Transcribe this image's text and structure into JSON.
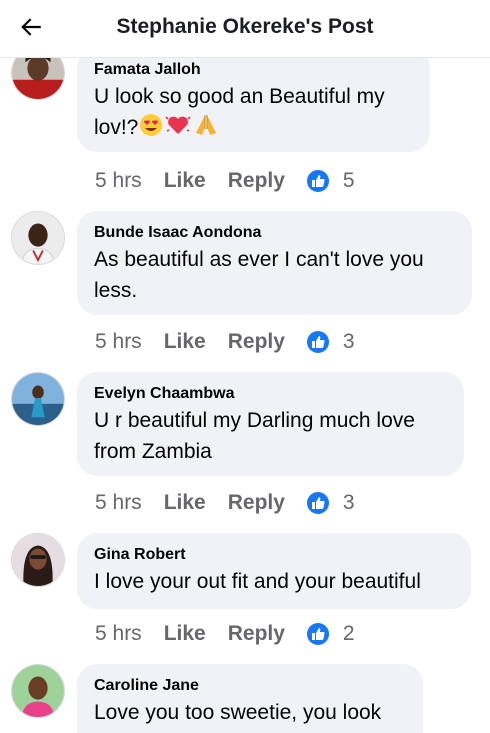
{
  "header": {
    "title": "Stephanie Okereke's Post",
    "back_icon": "arrow-left-icon"
  },
  "colors": {
    "bubble": "#f0f2f5",
    "meta": "#65676b",
    "like_blue": "#1877f2"
  },
  "comments": [
    {
      "author": "Famata Jalloh",
      "text_line1": "U look so good an Beautiful my",
      "text_line2": "lov!?",
      "emojis": [
        "heart-eyes-emoji",
        "sparkling-heart-emoji",
        "folded-hands-emoji"
      ],
      "time": "5 hrs",
      "like": "Like",
      "reply": "Reply",
      "reactions": "5"
    },
    {
      "author": "Bunde Isaac Aondona",
      "text_line1": "As beautiful as ever I can't love you",
      "text_line2": "less.",
      "time": "5 hrs",
      "like": "Like",
      "reply": "Reply",
      "reactions": "3"
    },
    {
      "author": "Evelyn Chaambwa",
      "text_line1": "U r beautiful my Darling much love",
      "text_line2": "from Zambia",
      "time": "5 hrs",
      "like": "Like",
      "reply": "Reply",
      "reactions": "3"
    },
    {
      "author": "Gina Robert",
      "text_line1": "I love your out fit and your beautiful",
      "time": "5 hrs",
      "like": "Like",
      "reply": "Reply",
      "reactions": "2"
    },
    {
      "author": "Caroline Jane",
      "text_line1": "Love you too sweetie, you look"
    }
  ]
}
